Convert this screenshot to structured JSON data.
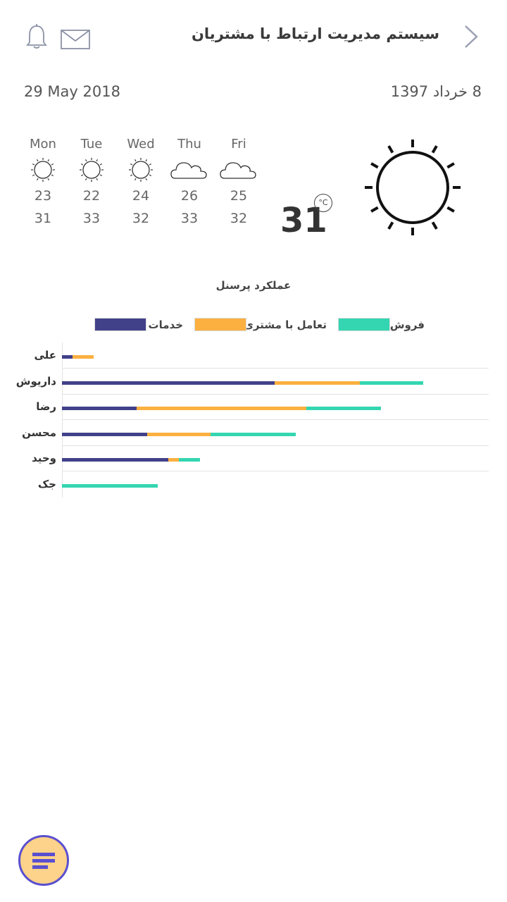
{
  "header": {
    "title": "سیستم مدیریت ارتباط با مشتریان"
  },
  "dates": {
    "gregorian": "29 May 2018",
    "persian": "8 خرداد 1397"
  },
  "weather": {
    "current_temp": "31",
    "unit_symbol": "°C",
    "current_icon": "sun-icon",
    "forecast": [
      {
        "day": "Mon",
        "icon": "sun-icon",
        "low": "23",
        "high": "31"
      },
      {
        "day": "Tue",
        "icon": "sun-icon",
        "low": "22",
        "high": "33"
      },
      {
        "day": "Wed",
        "icon": "sun-icon",
        "low": "24",
        "high": "32"
      },
      {
        "day": "Thu",
        "icon": "cloud-icon",
        "low": "26",
        "high": "33"
      },
      {
        "day": "Fri",
        "icon": "cloud-icon",
        "low": "25",
        "high": "32"
      }
    ]
  },
  "chart_data": {
    "type": "bar",
    "orientation": "horizontal",
    "stacked": true,
    "title": "عملکرد پرسنل",
    "categories": [
      "علی",
      "داریوش",
      "رضا",
      "محسن",
      "وحید",
      "جک"
    ],
    "series": [
      {
        "name": "خدمات",
        "color": "#41418a",
        "values": [
          1,
          20,
          7,
          8,
          10,
          0
        ]
      },
      {
        "name": "تعامل با مشتری",
        "color": "#fbb040",
        "values": [
          2,
          8,
          16,
          6,
          1,
          0
        ]
      },
      {
        "name": "فروش",
        "color": "#33d6b0",
        "values": [
          0,
          6,
          7,
          8,
          2,
          9
        ]
      }
    ],
    "legend_position": "top",
    "grid": true
  }
}
